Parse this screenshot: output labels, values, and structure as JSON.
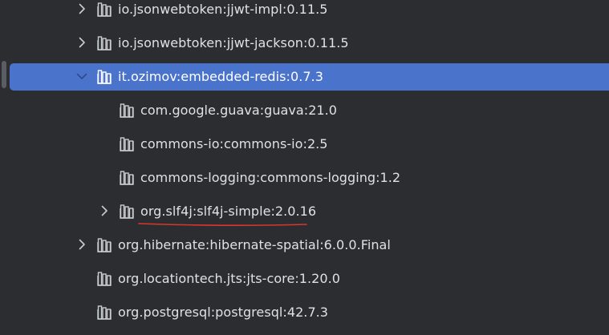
{
  "dependency_tree": {
    "items": [
      {
        "label": "io.jsonwebtoken:jjwt-impl:0.11.5",
        "expander": "collapsed"
      },
      {
        "label": "io.jsonwebtoken:jjwt-jackson:0.11.5",
        "expander": "collapsed"
      },
      {
        "label": "it.ozimov:embedded-redis:0.7.3",
        "expander": "expanded",
        "selected": true
      },
      {
        "label": "com.google.guava:guava:21.0",
        "expander": "none"
      },
      {
        "label": "commons-io:commons-io:2.5",
        "expander": "none"
      },
      {
        "label": "commons-logging:commons-logging:1.2",
        "expander": "none"
      },
      {
        "label": "org.slf4j:slf4j-simple:2.0.16",
        "expander": "collapsed",
        "underlined": true
      },
      {
        "label": "org.hibernate:hibernate-spatial:6.0.0.Final",
        "expander": "collapsed"
      },
      {
        "label": "org.locationtech.jts:jts-core:1.20.0",
        "expander": "none"
      },
      {
        "label": "org.postgresql:postgresql:42.7.3",
        "expander": "none"
      }
    ]
  },
  "icons": {
    "library": "library-icon",
    "expand": "chevron-right-icon",
    "collapse": "chevron-down-icon"
  },
  "colors": {
    "background": "#2b2d30",
    "selection": "#4a73cc",
    "text": "#dfe1e5",
    "annotation": "#d9362f"
  }
}
